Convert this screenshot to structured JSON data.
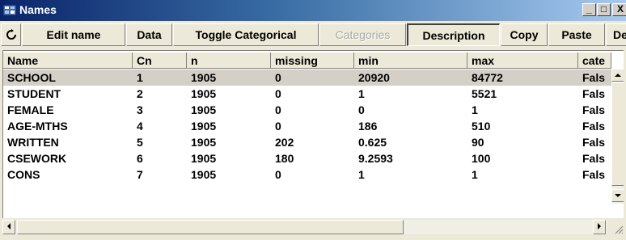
{
  "window": {
    "title": "Names",
    "minimize": "_",
    "maximize": "□",
    "close": "X"
  },
  "toolbar": {
    "refresh": "O",
    "edit_name": "Edit name",
    "data": "Data",
    "toggle_categorical": "Toggle Categorical",
    "categories": "Categories",
    "description": "Description",
    "copy": "Copy",
    "paste": "Paste",
    "next": "De"
  },
  "table": {
    "columns": [
      "Name",
      "Cn",
      "n",
      "missing",
      "min",
      "max",
      "cate"
    ],
    "rows": [
      [
        "SCHOOL",
        "1",
        "1905",
        "0",
        "20920",
        "84772",
        "Fals"
      ],
      [
        "STUDENT",
        "2",
        "1905",
        "0",
        "1",
        "5521",
        "Fals"
      ],
      [
        "FEMALE",
        "3",
        "1905",
        "0",
        "0",
        "1",
        "Fals"
      ],
      [
        "AGE-MTHS",
        "4",
        "1905",
        "0",
        "186",
        "510",
        "Fals"
      ],
      [
        "WRITTEN",
        "5",
        "1905",
        "202",
        "0.625",
        "90",
        "Fals"
      ],
      [
        "CSEWORK",
        "6",
        "1905",
        "180",
        "9.2593",
        "100",
        "Fals"
      ],
      [
        "CONS",
        "7",
        "1905",
        "0",
        "1",
        "1",
        "Fals"
      ]
    ],
    "selected_row": 0
  }
}
